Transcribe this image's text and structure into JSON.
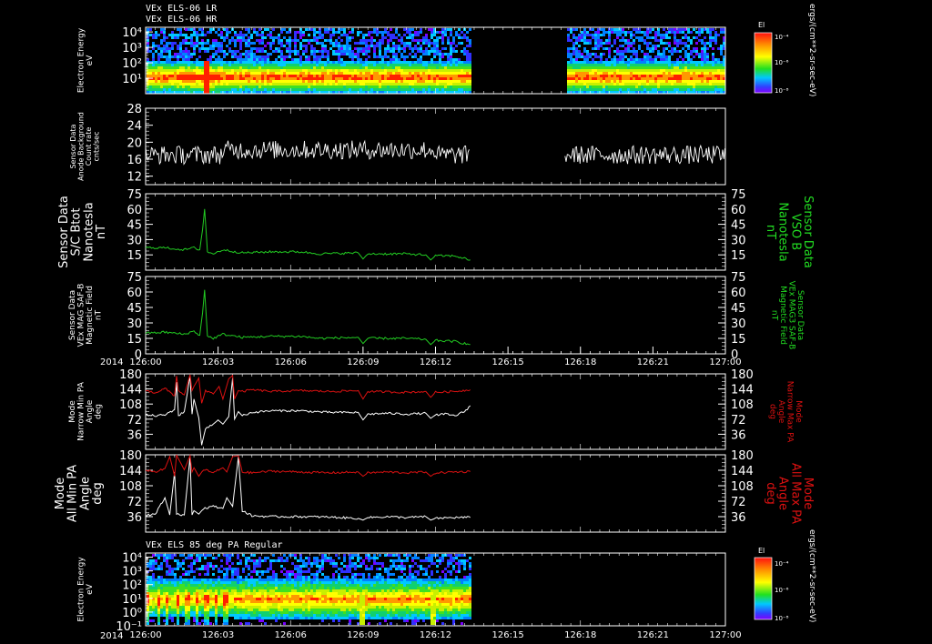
{
  "page": {
    "header_lines": [
      "VEx ELS-06 LR",
      "VEx ELS-06 HR"
    ],
    "bottom_spectrogram_title": "VEx ELS 85 deg PA Regular",
    "year_label": "2014",
    "colorbar_unit": "ergs/(cm**2-sr-sec-eV)",
    "colorbar_label": "El"
  },
  "colors": {
    "background": "#000000",
    "white_trace": "#ffffff",
    "green_trace": "#22cc22",
    "red_trace": "#dd1111",
    "green_label": "#22dd22",
    "red_label": "#dd1111"
  },
  "chart_data": [
    {
      "id": "spec1",
      "type": "heatmap",
      "ylabel": [
        "Electron Energy",
        "eV"
      ],
      "y_log": true,
      "ylim": [
        1,
        20000
      ],
      "ytick_labels": [
        "10⁴",
        "10³",
        "10²",
        "10¹"
      ],
      "ytick_values": [
        10000,
        1000,
        100,
        10
      ],
      "xlim": [
        0,
        60
      ],
      "data_gap": [
        [
          33.6,
          43.4
        ]
      ],
      "colorbar": {
        "label": "El",
        "ticks": [
          "10⁻⁴",
          "10⁻⁶",
          "10⁻⁸"
        ]
      }
    },
    {
      "id": "bkg",
      "type": "line",
      "ylabel": [
        "Sensor Data",
        "Anode Background",
        "Count rate",
        "cnts/sec"
      ],
      "ylim": [
        10,
        28
      ],
      "ytick_values": [
        28,
        24,
        20,
        16,
        12
      ],
      "series": [
        {
          "segments": [
            [
              0,
              33.6
            ],
            [
              43.4,
              60
            ]
          ],
          "mean": 17,
          "noise": 2.2
        }
      ]
    },
    {
      "id": "btot",
      "type": "line",
      "ylabel": [
        "Sensor Data",
        "S/C Btot",
        "Nanotesla",
        "nT"
      ],
      "right_label": [
        "Sensor Data",
        "VSO B",
        "Nanotesla",
        "nT"
      ],
      "ylim": [
        0,
        75
      ],
      "ytick_values": [
        75,
        60,
        45,
        30,
        15
      ],
      "series": [
        {
          "x_range": [
            0,
            33.6
          ],
          "points": [
            [
              0,
              22
            ],
            [
              2,
              22
            ],
            [
              4,
              20
            ],
            [
              5,
              22
            ],
            [
              5.6,
              20
            ],
            [
              5.9,
              40
            ],
            [
              6.1,
              60
            ],
            [
              6.4,
              18
            ],
            [
              7,
              16
            ],
            [
              8,
              20
            ],
            [
              10,
              17
            ],
            [
              13,
              18
            ],
            [
              16,
              18
            ],
            [
              18,
              16
            ],
            [
              22,
              17
            ],
            [
              22.5,
              11
            ],
            [
              23,
              16
            ],
            [
              27,
              16
            ],
            [
              29,
              15
            ],
            [
              29.5,
              10
            ],
            [
              30,
              14
            ],
            [
              32,
              14
            ],
            [
              33.6,
              10
            ]
          ]
        }
      ]
    },
    {
      "id": "bsaf",
      "type": "line",
      "ylabel": [
        "Sensor Data",
        "VEx MAG SAF-B",
        "Magnetic Field",
        "nT"
      ],
      "right_label": [
        "Sensor Data",
        "VEx MAG3 SAF-B",
        "Magnetic Field",
        "nT"
      ],
      "ylim": [
        0,
        75
      ],
      "ytick_values": [
        75,
        60,
        45,
        30,
        15,
        0
      ],
      "xaxis_ticks": [
        "126:00",
        "126:03",
        "126:06",
        "126:09",
        "126:12",
        "126:15",
        "126:18",
        "126:21",
        "127:00"
      ],
      "series": [
        {
          "x_range": [
            0,
            33.6
          ],
          "points": [
            [
              0,
              20
            ],
            [
              2,
              21
            ],
            [
              4,
              19
            ],
            [
              5,
              22
            ],
            [
              5.6,
              18
            ],
            [
              5.9,
              40
            ],
            [
              6.1,
              62
            ],
            [
              6.4,
              17
            ],
            [
              7,
              15
            ],
            [
              8,
              19
            ],
            [
              10,
              16
            ],
            [
              13,
              17
            ],
            [
              16,
              17
            ],
            [
              18,
              15
            ],
            [
              22,
              16
            ],
            [
              22.5,
              10
            ],
            [
              23,
              15
            ],
            [
              27,
              15
            ],
            [
              29,
              14
            ],
            [
              29.5,
              9
            ],
            [
              30,
              13
            ],
            [
              32,
              12
            ],
            [
              33.6,
              9
            ]
          ]
        }
      ]
    },
    {
      "id": "narrow_pa",
      "type": "line",
      "ylabel": [
        "Mode",
        "Narrow Min PA",
        "Angle",
        "deg"
      ],
      "right_label": [
        "Mode",
        "Narrow Max PA",
        "Angle",
        "deg"
      ],
      "ylim": [
        0,
        180
      ],
      "ytick_values": [
        180,
        144,
        108,
        72,
        36
      ],
      "series": [
        {
          "name": "min",
          "color": "white",
          "points": [
            [
              0,
              82
            ],
            [
              1,
              80
            ],
            [
              2,
              82
            ],
            [
              3,
              95
            ],
            [
              3.2,
              160
            ],
            [
              3.4,
              80
            ],
            [
              4,
              90
            ],
            [
              4.6,
              175
            ],
            [
              4.8,
              84
            ],
            [
              5,
              120
            ],
            [
              5.5,
              75
            ],
            [
              5.8,
              10
            ],
            [
              6.2,
              50
            ],
            [
              7,
              60
            ],
            [
              7.5,
              70
            ],
            [
              8,
              60
            ],
            [
              8.6,
              78
            ],
            [
              9,
              170
            ],
            [
              9.2,
              72
            ],
            [
              9.6,
              90
            ],
            [
              10,
              80
            ],
            [
              11,
              88
            ],
            [
              13,
              92
            ],
            [
              16,
              92
            ],
            [
              19,
              88
            ],
            [
              22,
              88
            ],
            [
              22.5,
              70
            ],
            [
              23,
              84
            ],
            [
              25,
              86
            ],
            [
              27,
              84
            ],
            [
              29,
              86
            ],
            [
              29.5,
              74
            ],
            [
              30,
              82
            ],
            [
              31,
              84
            ],
            [
              32,
              80
            ],
            [
              33,
              90
            ],
            [
              33.6,
              104
            ]
          ]
        },
        {
          "name": "max",
          "color": "red",
          "points": [
            [
              0,
              140
            ],
            [
              1,
              135
            ],
            [
              2,
              145
            ],
            [
              3,
              128
            ],
            [
              3.2,
              175
            ],
            [
              3.4,
              140
            ],
            [
              4,
              130
            ],
            [
              4.6,
              178
            ],
            [
              4.8,
              140
            ],
            [
              5,
              150
            ],
            [
              5.5,
              170
            ],
            [
              5.8,
              110
            ],
            [
              6.2,
              140
            ],
            [
              7,
              132
            ],
            [
              7.6,
              150
            ],
            [
              8,
              120
            ],
            [
              8.6,
              168
            ],
            [
              9,
              176
            ],
            [
              9.2,
              120
            ],
            [
              9.6,
              140
            ],
            [
              10,
              138
            ],
            [
              11,
              142
            ],
            [
              13,
              138
            ],
            [
              16,
              140
            ],
            [
              19,
              138
            ],
            [
              22,
              140
            ],
            [
              22.5,
              120
            ],
            [
              23,
              138
            ],
            [
              25,
              137
            ],
            [
              27,
              136
            ],
            [
              29,
              138
            ],
            [
              29.5,
              124
            ],
            [
              30,
              136
            ],
            [
              32,
              138
            ],
            [
              33.6,
              142
            ]
          ]
        }
      ]
    },
    {
      "id": "all_pa",
      "type": "line",
      "ylabel": [
        "Mode",
        "All Min PA",
        "Angle",
        "deg"
      ],
      "right_label": [
        "Mode",
        "All Max PA",
        "Angle",
        "deg"
      ],
      "ylim": [
        0,
        180
      ],
      "ytick_values": [
        180,
        144,
        108,
        72,
        36
      ],
      "series": [
        {
          "name": "min",
          "color": "white",
          "points": [
            [
              0,
              40
            ],
            [
              1,
              42
            ],
            [
              2,
              80
            ],
            [
              2.5,
              40
            ],
            [
              3,
              140
            ],
            [
              3.2,
              42
            ],
            [
              4,
              40
            ],
            [
              4.6,
              175
            ],
            [
              4.8,
              40
            ],
            [
              5,
              50
            ],
            [
              5.5,
              42
            ],
            [
              6,
              55
            ],
            [
              7,
              60
            ],
            [
              8,
              55
            ],
            [
              8.4,
              80
            ],
            [
              9,
              60
            ],
            [
              9.6,
              175
            ],
            [
              10,
              50
            ],
            [
              11,
              38
            ],
            [
              13,
              36
            ],
            [
              16,
              36
            ],
            [
              19,
              35
            ],
            [
              22,
              32
            ],
            [
              22.5,
              28
            ],
            [
              23,
              34
            ],
            [
              25,
              36
            ],
            [
              27,
              34
            ],
            [
              29,
              36
            ],
            [
              29.5,
              28
            ],
            [
              30,
              32
            ],
            [
              32,
              34
            ],
            [
              33.6,
              34
            ]
          ]
        },
        {
          "name": "max",
          "color": "red",
          "points": [
            [
              0,
              145
            ],
            [
              1,
              140
            ],
            [
              2,
              148
            ],
            [
              2.5,
              176
            ],
            [
              3,
              130
            ],
            [
              3.2,
              178
            ],
            [
              4,
              145
            ],
            [
              4.6,
              178
            ],
            [
              4.8,
              140
            ],
            [
              5,
              150
            ],
            [
              5.5,
              130
            ],
            [
              6,
              146
            ],
            [
              7,
              138
            ],
            [
              8,
              150
            ],
            [
              8.4,
              140
            ],
            [
              9,
              176
            ],
            [
              9.6,
              178
            ],
            [
              10,
              140
            ],
            [
              11,
              138
            ],
            [
              13,
              142
            ],
            [
              16,
              140
            ],
            [
              19,
              138
            ],
            [
              22,
              140
            ],
            [
              22.5,
              130
            ],
            [
              23,
              138
            ],
            [
              25,
              140
            ],
            [
              27,
              138
            ],
            [
              29,
              140
            ],
            [
              29.5,
              130
            ],
            [
              30,
              138
            ],
            [
              32,
              140
            ],
            [
              33.6,
              141
            ]
          ]
        }
      ]
    },
    {
      "id": "spec2",
      "type": "heatmap",
      "ylabel": [
        "Electron Energy",
        "eV"
      ],
      "y_log": true,
      "ylim": [
        0.1,
        20000
      ],
      "ytick_labels": [
        "10⁴",
        "10³",
        "10²",
        "10¹",
        "10⁰",
        "10⁻¹"
      ],
      "ytick_values": [
        10000,
        1000,
        100,
        10,
        1,
        0.1
      ],
      "xlim": [
        0,
        60
      ],
      "data_range": [
        0,
        33.6
      ],
      "colorbar": {
        "label": "El",
        "ticks": [
          "10⁻⁴",
          "10⁻⁶",
          "10⁻⁸"
        ]
      }
    }
  ]
}
